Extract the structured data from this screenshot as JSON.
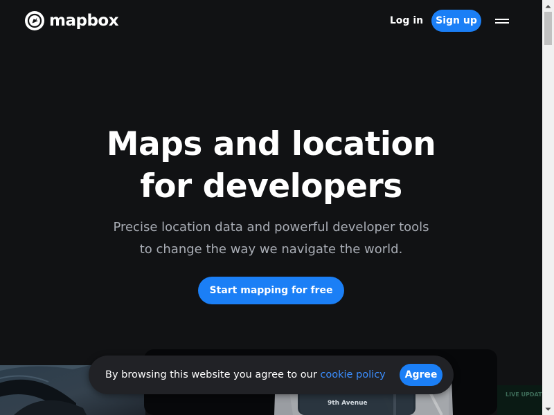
{
  "header": {
    "brand": "mapbox",
    "login_label": "Log in",
    "signup_label": "Sign up",
    "menu_icon": "hamburger-menu-icon"
  },
  "hero": {
    "title_line1": "Maps and location",
    "title_line2": "for developers",
    "subtitle_line1": "Precise location data and powerful developer tools",
    "subtitle_line2": "to change the way we navigate the world.",
    "cta_label": "Start mapping for free"
  },
  "preview": {
    "street_label": "9th Avenue",
    "badge_label": "LIVE UPDATES"
  },
  "cookie_banner": {
    "text": "By browsing this website you agree to our ",
    "link_label": "cookie policy",
    "agree_label": "Agree"
  },
  "colors": {
    "background": "#111214",
    "accent": "#1b7ff6",
    "link": "#3b8eff",
    "subtitle": "#a9adb5",
    "banner": "#212226"
  }
}
